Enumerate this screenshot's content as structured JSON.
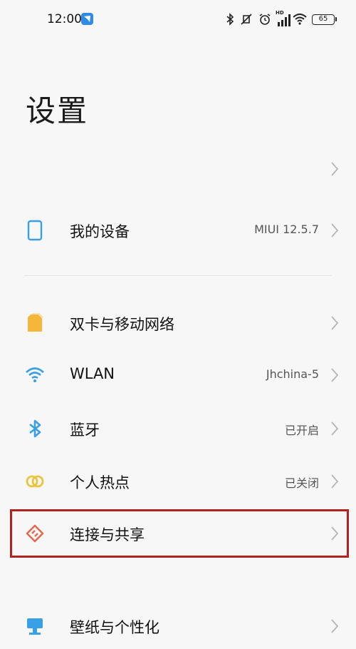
{
  "status_bar": {
    "time": "12:00",
    "hd_label": "HD",
    "battery": "65"
  },
  "title": "设置",
  "account_row": {
    "chevron": "chevron-right-icon"
  },
  "rows": [
    {
      "id": "my-device",
      "label": "我的设备",
      "value": "MIUI 12.5.7",
      "icon": "phone-icon",
      "color": "#3aa0e6"
    },
    {
      "id": "sim-mobile",
      "label": "双卡与移动网络",
      "value": "",
      "icon": "sim-card-icon",
      "color": "#f4b73a"
    },
    {
      "id": "wlan",
      "label": "WLAN",
      "value": "Jhchina-5",
      "icon": "wifi-icon",
      "color": "#3aa0e6"
    },
    {
      "id": "bluetooth",
      "label": "蓝牙",
      "value": "已开启",
      "icon": "bluetooth-icon",
      "color": "#3aa0e6"
    },
    {
      "id": "hotspot",
      "label": "个人热点",
      "value": "已关闭",
      "icon": "hotspot-icon",
      "color": "#e8c53a"
    },
    {
      "id": "connection-sharing",
      "label": "连接与共享",
      "value": "",
      "icon": "connection-share-icon",
      "color": "#e36a4f"
    },
    {
      "id": "wallpaper",
      "label": "壁纸与个性化",
      "value": "",
      "icon": "wallpaper-icon",
      "color": "#3aa0e6"
    }
  ],
  "highlight_color": "#b3201d"
}
